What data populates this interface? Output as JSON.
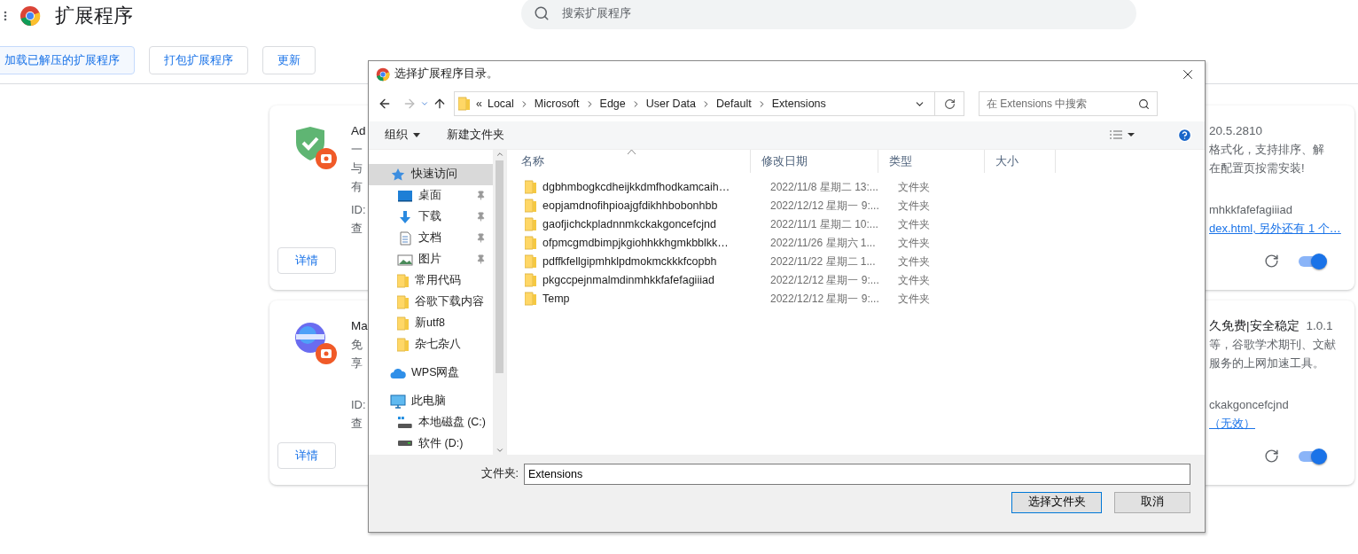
{
  "page": {
    "title": "扩展程序",
    "search_placeholder": "搜索扩展程序"
  },
  "toolbar": [
    {
      "label": "加载已解压的扩展程序",
      "focused": true
    },
    {
      "label": "打包扩展程序",
      "focused": false
    },
    {
      "label": "更新",
      "focused": false
    }
  ],
  "cards": [
    {
      "enabled": true,
      "detail_button": "详情",
      "left": {
        "title": "Ad",
        "desc": [
          "一",
          "与",
          "有"
        ],
        "id": "ID:",
        "view": "查"
      },
      "right": {
        "version": "20.5.2810",
        "desc": [
          "格式化，支持排序、解",
          "在配置页按需安装!"
        ],
        "id": "mhkkfafefagiiiad",
        "link": "dex.html, 另外还有 1 个…"
      }
    },
    {
      "enabled": true,
      "detail_button": "详情",
      "left": {
        "title": "Ma",
        "desc": [
          "免",
          "享"
        ],
        "id": "ID:",
        "view": "查"
      },
      "right": {
        "title": "久免费|安全稳定",
        "version": "1.0.1",
        "desc": [
          "等，谷歌学术期刊、文献",
          "服务的上网加速工具。"
        ],
        "id": "ckakgoncefcjnd",
        "link": "（无效）"
      }
    }
  ],
  "dialog": {
    "title": "选择扩展程序目录。",
    "path_prefix": "«",
    "path": [
      "Local",
      "Microsoft",
      "Edge",
      "User Data",
      "Default",
      "Extensions"
    ],
    "search_placeholder": "在 Extensions 中搜索",
    "organize": "组织",
    "new_folder": "新建文件夹",
    "nav": [
      {
        "label": "快速访问",
        "kind": "star",
        "selected": true,
        "children": [
          {
            "label": "桌面",
            "kind": "desktop",
            "pinned": true,
            "selected": false
          },
          {
            "label": "下载",
            "kind": "download",
            "pinned": true,
            "selected": false
          },
          {
            "label": "文档",
            "kind": "document",
            "pinned": true,
            "selected": false
          },
          {
            "label": "图片",
            "kind": "picture",
            "pinned": true,
            "selected": false
          },
          {
            "label": "常用代码",
            "kind": "folder",
            "pinned": false,
            "selected": false
          },
          {
            "label": "谷歌下载内容",
            "kind": "folder",
            "pinned": false,
            "selected": false
          },
          {
            "label": "新utf8",
            "kind": "folder",
            "pinned": false,
            "selected": false
          },
          {
            "label": "杂七杂八",
            "kind": "folder",
            "pinned": false,
            "selected": false
          }
        ]
      },
      {
        "label": "WPS网盘",
        "kind": "cloud",
        "selected": false
      },
      {
        "label": "此电脑",
        "kind": "computer",
        "selected": false,
        "children": [
          {
            "label": "本地磁盘 (C:)",
            "kind": "system-drive",
            "pinned": false,
            "selected": false
          },
          {
            "label": "软件 (D:)",
            "kind": "drive",
            "pinned": false,
            "selected": false
          }
        ]
      }
    ],
    "columns": [
      "名称",
      "修改日期",
      "类型",
      "大小"
    ],
    "files": [
      {
        "name": "dgbhmbogkcdheijkkdmfhodkamcaih…",
        "date": "2022/11/8 星期二 13:...",
        "type": "文件夹"
      },
      {
        "name": "eopjamdnofihpioajgfdikhhbobonhbb",
        "date": "2022/12/12 星期一 9:...",
        "type": "文件夹"
      },
      {
        "name": "gaofjichckpladnnmkckakgoncefcjnd",
        "date": "2022/11/1 星期二 10:...",
        "type": "文件夹"
      },
      {
        "name": "ofpmcgmdbimpjkgiohhkkhgmkbblkk…",
        "date": "2022/11/26 星期六 1...",
        "type": "文件夹"
      },
      {
        "name": "pdffkfellgipmhklpdmokmckkkfcopbh",
        "date": "2022/11/22 星期二 1...",
        "type": "文件夹"
      },
      {
        "name": "pkgccpejnmalmdinmhkkfafefagiiiad",
        "date": "2022/12/12 星期一 9:...",
        "type": "文件夹"
      },
      {
        "name": "Temp",
        "date": "2022/12/12 星期一 9:...",
        "type": "文件夹"
      }
    ],
    "folder_label": "文件夹:",
    "folder_value": "Extensions",
    "buttons": [
      {
        "label": "选择文件夹",
        "primary": true
      },
      {
        "label": "取消",
        "primary": false
      }
    ]
  }
}
